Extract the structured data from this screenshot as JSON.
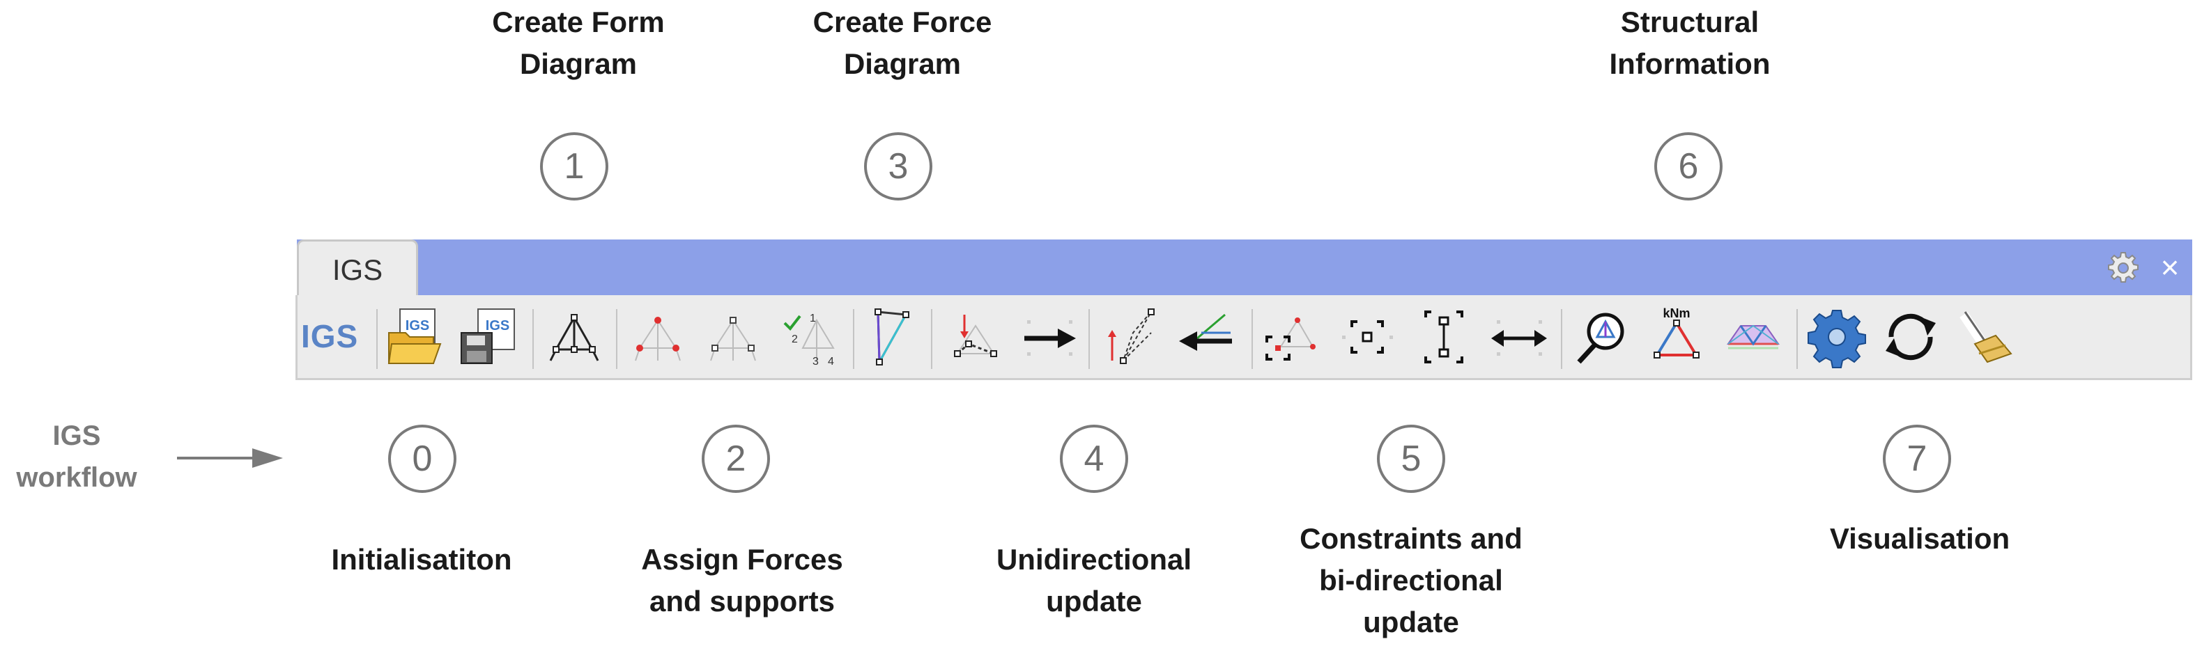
{
  "top_labels": [
    {
      "line1": "Create Form",
      "line2": "Diagram"
    },
    {
      "line1": "Create Force",
      "line2": "Diagram"
    },
    {
      "line1": "Structural",
      "line2": "Information"
    }
  ],
  "top_steps": [
    "1",
    "3",
    "6"
  ],
  "bottom_steps": [
    "0",
    "2",
    "4",
    "5",
    "7"
  ],
  "bottom_labels": [
    {
      "line1": "Initialisatiton"
    },
    {
      "line1": "Assign Forces",
      "line2": "and supports"
    },
    {
      "line1": "Unidirectional",
      "line2": "update"
    },
    {
      "line1": "Constraints and",
      "line2": "bi-directional",
      "line3": "update"
    },
    {
      "line1": "Visualisation"
    }
  ],
  "side": {
    "line1": "IGS",
    "line2": "workflow"
  },
  "toolbar": {
    "tab_label": "IGS",
    "logo_text": "IGS",
    "open_file_text": "IGS",
    "save_file_text": "IGS",
    "kNm_text": "kNm",
    "num_text": {
      "a": "1",
      "b": "2",
      "c": "3",
      "d": "4"
    }
  },
  "colors": {
    "tab_bar": "#8ca0e8",
    "toolbar_bg": "#ececec",
    "circle": "#7a7a7a",
    "accent_blue": "#5a84c6",
    "red": "#e03030"
  }
}
